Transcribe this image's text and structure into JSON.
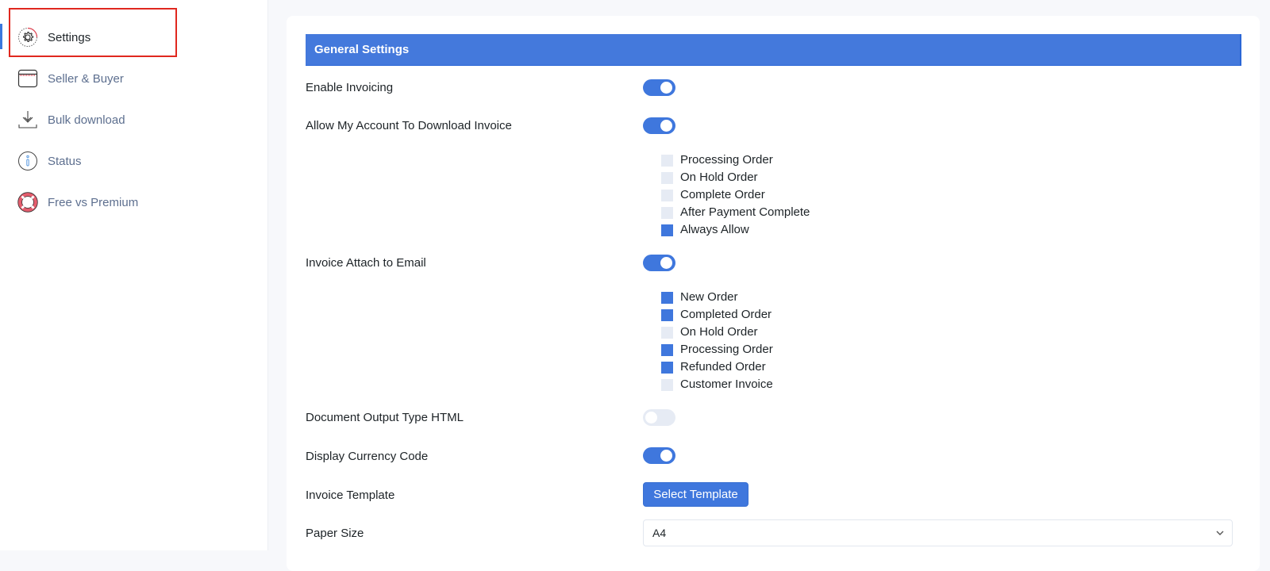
{
  "sidebar": {
    "items": [
      {
        "label": "Settings",
        "icon": "gear-icon",
        "active": true
      },
      {
        "label": "Seller & Buyer",
        "icon": "store-icon"
      },
      {
        "label": "Bulk download",
        "icon": "download-icon"
      },
      {
        "label": "Status",
        "icon": "info-icon"
      },
      {
        "label": "Free vs Premium",
        "icon": "lifebuoy-icon"
      }
    ]
  },
  "colors": {
    "accent": "#4479dc",
    "toggle_on": "#3f77dd",
    "toggle_off": "#e6ebf4",
    "highlight": "#e0281f"
  },
  "section": {
    "title": "General Settings"
  },
  "settings": {
    "enable_invoicing": {
      "label": "Enable Invoicing",
      "enabled": true
    },
    "allow_download": {
      "label": "Allow My Account To Download Invoice",
      "enabled": true,
      "options": [
        {
          "label": "Processing Order",
          "checked": false
        },
        {
          "label": "On Hold Order",
          "checked": false
        },
        {
          "label": "Complete Order",
          "checked": false
        },
        {
          "label": "After Payment Complete",
          "checked": false
        },
        {
          "label": "Always Allow",
          "checked": true
        }
      ]
    },
    "attach_email": {
      "label": "Invoice Attach to Email",
      "enabled": true,
      "options": [
        {
          "label": "New Order",
          "checked": true
        },
        {
          "label": "Completed Order",
          "checked": true
        },
        {
          "label": "On Hold Order",
          "checked": false
        },
        {
          "label": "Processing Order",
          "checked": true
        },
        {
          "label": "Refunded Order",
          "checked": true
        },
        {
          "label": "Customer Invoice",
          "checked": false
        }
      ]
    },
    "output_html": {
      "label": "Document Output Type HTML",
      "enabled": false
    },
    "currency_code": {
      "label": "Display Currency Code",
      "enabled": true
    },
    "invoice_template": {
      "label": "Invoice Template",
      "button_label": "Select Template"
    },
    "paper_size": {
      "label": "Paper Size",
      "value": "A4"
    }
  }
}
